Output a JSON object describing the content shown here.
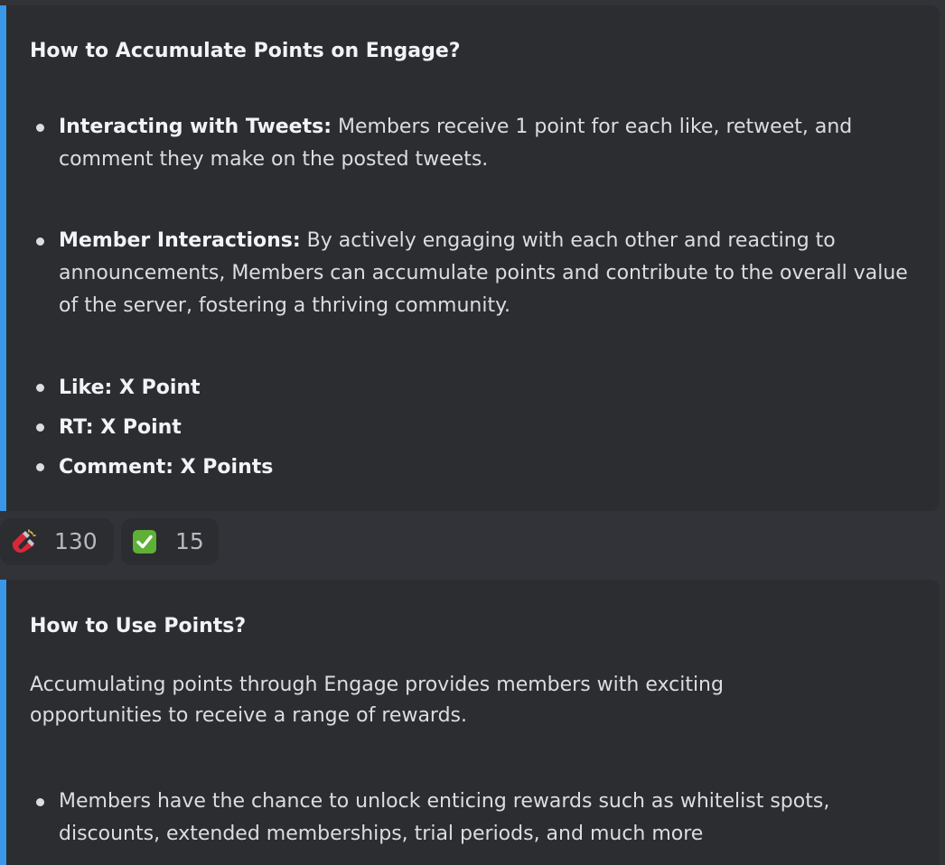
{
  "embeds": [
    {
      "title": "How to Accumulate Points on Engage?",
      "list_a": [
        {
          "bold": "Interacting with Tweets:",
          "text": " Members receive 1 point for each like, retweet, and comment they make on the posted tweets."
        }
      ],
      "list_b": [
        {
          "bold": "Member Interactions:",
          "text": " By actively engaging with each other and reacting to announcements, Members can accumulate points and contribute to the overall value of the server, fostering a thriving community."
        }
      ],
      "list_c": [
        "Like: X Point",
        "RT: X Point",
        "Comment: X Points"
      ]
    },
    {
      "title": "How to Use Points?",
      "paragraph": "Accumulating points through Engage provides members with exciting opportunities to receive a range of rewards.",
      "list_d": [
        "Members have the chance to unlock enticing rewards such as whitelist spots, discounts, extended memberships, trial periods, and much more"
      ]
    }
  ],
  "accent_color": "#3a97e8",
  "reactions": [
    {
      "icon": "magnet-icon",
      "count": "130"
    },
    {
      "icon": "check-mark-icon",
      "count": "15"
    }
  ]
}
